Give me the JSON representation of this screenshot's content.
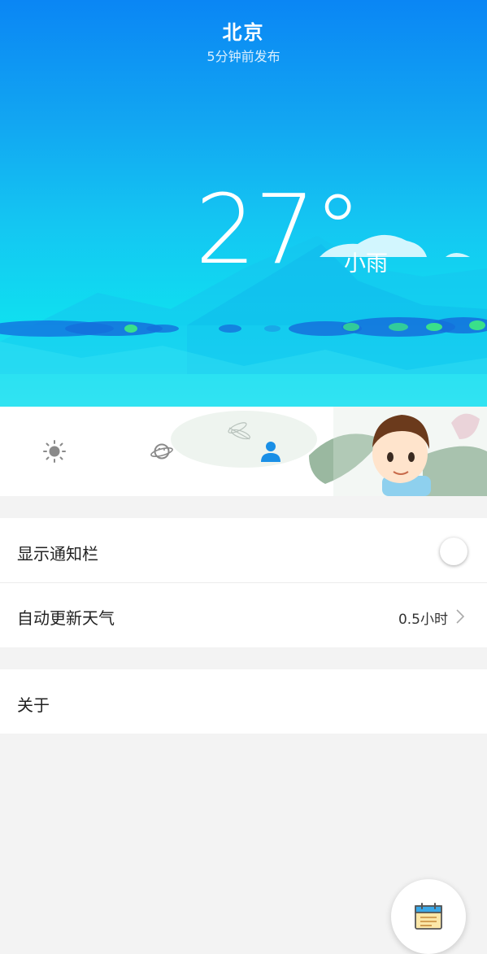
{
  "header": {
    "city": "北京",
    "published": "5分钟前发布"
  },
  "weather": {
    "temperature": "27°",
    "condition": "小雨"
  },
  "tabs": [
    {
      "icon": "sun-icon",
      "active": false
    },
    {
      "icon": "planet-icon",
      "active": false
    },
    {
      "icon": "user-icon",
      "active": true
    }
  ],
  "settings": {
    "show_notification_label": "显示通知栏",
    "show_notification_on": false,
    "auto_update_label": "自动更新天气",
    "auto_update_value": "0.5小时",
    "about_label": "关于"
  },
  "fab": {
    "icon": "calendar-note-icon"
  },
  "colors": {
    "accent": "#1a8fe6",
    "icon_gray": "#888888",
    "background": "#f3f3f3"
  }
}
